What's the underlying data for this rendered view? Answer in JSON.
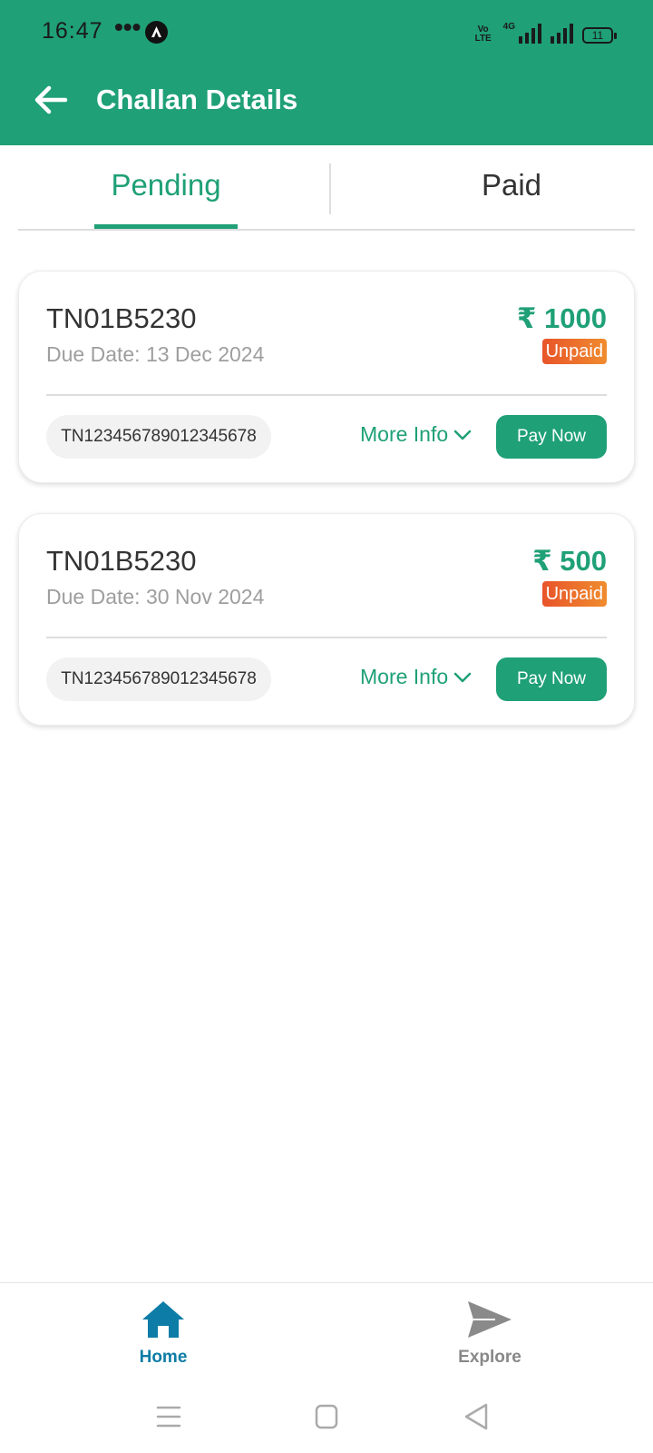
{
  "status_bar": {
    "time": "16:47",
    "dots": "•••",
    "network_label": "4G",
    "battery_level": "11",
    "icons": [
      "vo-lte-icon",
      "signal-4g-icon",
      "signal-icon",
      "battery-icon"
    ]
  },
  "header": {
    "title": "Challan Details",
    "back_icon": "arrow-left-icon",
    "background_color": "#1FA077"
  },
  "tabs": [
    {
      "label": "Pending",
      "active": true
    },
    {
      "label": "Paid",
      "active": false
    }
  ],
  "challans": [
    {
      "plate": "TN01B5230",
      "due_date": "Due Date: 13 Dec 2024",
      "amount": "₹ 1000",
      "status": "Unpaid",
      "challan_number": "TN123456789012345678",
      "more_info": "More Info",
      "pay_label": "Pay Now"
    },
    {
      "plate": "TN01B5230",
      "due_date": "Due Date: 30 Nov 2024",
      "amount": "₹ 500",
      "status": "Unpaid",
      "challan_number": "TN123456789012345678",
      "more_info": "More Info",
      "pay_label": "Pay Now"
    }
  ],
  "bottom_nav": [
    {
      "label": "Home",
      "icon": "home-icon",
      "active": true
    },
    {
      "label": "Explore",
      "icon": "send-icon",
      "active": false
    }
  ],
  "colors": {
    "primary": "#1FA077",
    "active_nav": "#0D7CA6",
    "badge_start": "#E8542A",
    "badge_end": "#F08C2E"
  }
}
